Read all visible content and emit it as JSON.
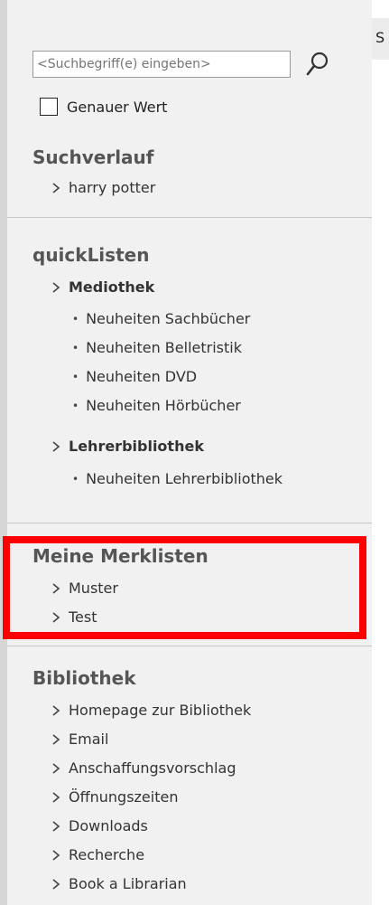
{
  "search": {
    "placeholder": "<Suchbegriff(e) eingeben>",
    "exact_label": "Genauer Wert"
  },
  "history": {
    "title": "Suchverlauf",
    "items": [
      "harry potter"
    ]
  },
  "quicklists": {
    "title": "quickListen",
    "groups": [
      {
        "label": "Mediothek",
        "items": [
          "Neuheiten Sachbücher",
          "Neuheiten Belletristik",
          "Neuheiten DVD",
          "Neuheiten Hörbücher"
        ]
      },
      {
        "label": "Lehrerbibliothek",
        "items": [
          "Neuheiten Lehrerbibliothek"
        ]
      }
    ]
  },
  "merklisten": {
    "title": "Meine Merklisten",
    "items": [
      "Muster",
      "Test"
    ]
  },
  "library": {
    "title": "Bibliothek",
    "items": [
      "Homepage zur Bibliothek",
      "Email",
      "Anschaffungsvorschlag",
      "Öffnungszeiten",
      "Downloads",
      "Recherche",
      "Book a Librarian"
    ]
  },
  "right_strip": {
    "text": "S"
  },
  "colors": {
    "sidebar_bg": "#f1f1f1",
    "highlight": "#ff0000",
    "title_text": "#555555"
  }
}
